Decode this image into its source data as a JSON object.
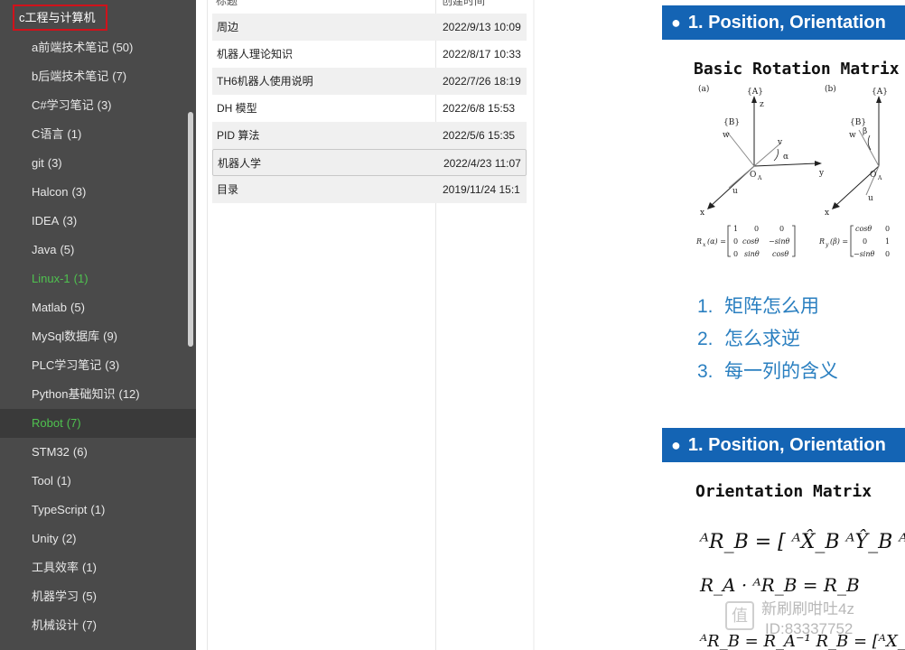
{
  "sidebar": {
    "root_label": "c工程与计算机",
    "items": [
      {
        "label": "a前端技术笔记",
        "count": "(50)"
      },
      {
        "label": "b后端技术笔记",
        "count": "(7)"
      },
      {
        "label": "C#学习笔记",
        "count": "(3)"
      },
      {
        "label": "C语言",
        "count": "(1)"
      },
      {
        "label": "git",
        "count": "(3)"
      },
      {
        "label": "Halcon",
        "count": "(3)"
      },
      {
        "label": "IDEA",
        "count": "(3)"
      },
      {
        "label": "Java",
        "count": "(5)"
      },
      {
        "label": "Linux-1",
        "count": "(1)"
      },
      {
        "label": "Matlab",
        "count": "(5)"
      },
      {
        "label": "MySql数据库",
        "count": "(9)"
      },
      {
        "label": "PLC学习笔记",
        "count": "(3)"
      },
      {
        "label": "Python基础知识",
        "count": "(12)"
      },
      {
        "label": "Robot",
        "count": "(7)"
      },
      {
        "label": "STM32",
        "count": "(6)"
      },
      {
        "label": "Tool",
        "count": "(1)"
      },
      {
        "label": "TypeScript",
        "count": "(1)"
      },
      {
        "label": "Unity",
        "count": "(2)"
      },
      {
        "label": "工具效率",
        "count": "(1)"
      },
      {
        "label": "机器学习",
        "count": "(5)"
      },
      {
        "label": "机械设计",
        "count": "(7)"
      }
    ],
    "highlight_color": "#4fc24f"
  },
  "note_list": {
    "header": {
      "title": "标题",
      "created": "创建时间"
    },
    "rows": [
      {
        "title": "周边",
        "created": "2022/9/13 10:09"
      },
      {
        "title": "机器人理论知识",
        "created": "2022/8/17 10:33"
      },
      {
        "title": "TH6机器人使用说明",
        "created": "2022/7/26 18:19"
      },
      {
        "title": "DH 模型",
        "created": "2022/6/8 15:53"
      },
      {
        "title": "PID 算法",
        "created": "2022/5/6 15:35"
      },
      {
        "title": "机器人学",
        "created": "2022/4/23 11:07"
      },
      {
        "title": "目录",
        "created": "2019/11/24 15:1"
      }
    ]
  },
  "document": {
    "slide1_title": "1. Position, Orientation",
    "slide1_subtitle": "Basic Rotation Matrix",
    "figure": {
      "label_a": "(a)",
      "label_b": "(b)",
      "frame_A": "{A}",
      "frame_B": "{B}",
      "axis_z": "z",
      "axis_y": "y",
      "axis_x": "x",
      "axis_u": "u",
      "axis_v": "v",
      "axis_w": "w",
      "origin": "O",
      "origin_sub": "A",
      "angle_alpha": "α",
      "angle_beta": "β",
      "rx_label": "R",
      "rx_sub": "x",
      "rx_arg": "(α) =",
      "rx_m1": "1",
      "rx_m2": "0",
      "rx_m3": "0",
      "rx_m4": "0",
      "rx_m5": "cosθ",
      "rx_m6": "−sinθ",
      "rx_m7": "0",
      "rx_m8": "sinθ",
      "rx_m9": "cosθ",
      "ry_label": "R",
      "ry_sub": "y",
      "ry_arg": "(β) =",
      "ry_m1": "cosθ",
      "ry_m2": "0",
      "ry_m4": "0",
      "ry_m5": "1",
      "ry_m7": "−sinθ",
      "ry_m8": "0"
    },
    "cn_items": [
      {
        "num": "1.",
        "text": "矩阵怎么用"
      },
      {
        "num": "2.",
        "text": "怎么求逆"
      },
      {
        "num": "3.",
        "text": "每一列的含义"
      }
    ],
    "slide2_title": "1. Position, Orientation",
    "slide2_subtitle": "Orientation Matrix",
    "eq1": "ᴬR_B = [ ᴬX̂_B   ᴬŶ_B   ᴬẐ_B ]",
    "eq2": "R_A · ᴬR_B = R_B",
    "eq3": "ᴬR_B = R_A⁻¹ R_B = [ᴬX_Bᵀ] [X",
    "accent_color": "#1464b4",
    "list_color": "#2a7fc0"
  },
  "watermark": {
    "logo": "值",
    "line1": "新刷刷咁吐4z",
    "line2": "ID:83337752"
  }
}
